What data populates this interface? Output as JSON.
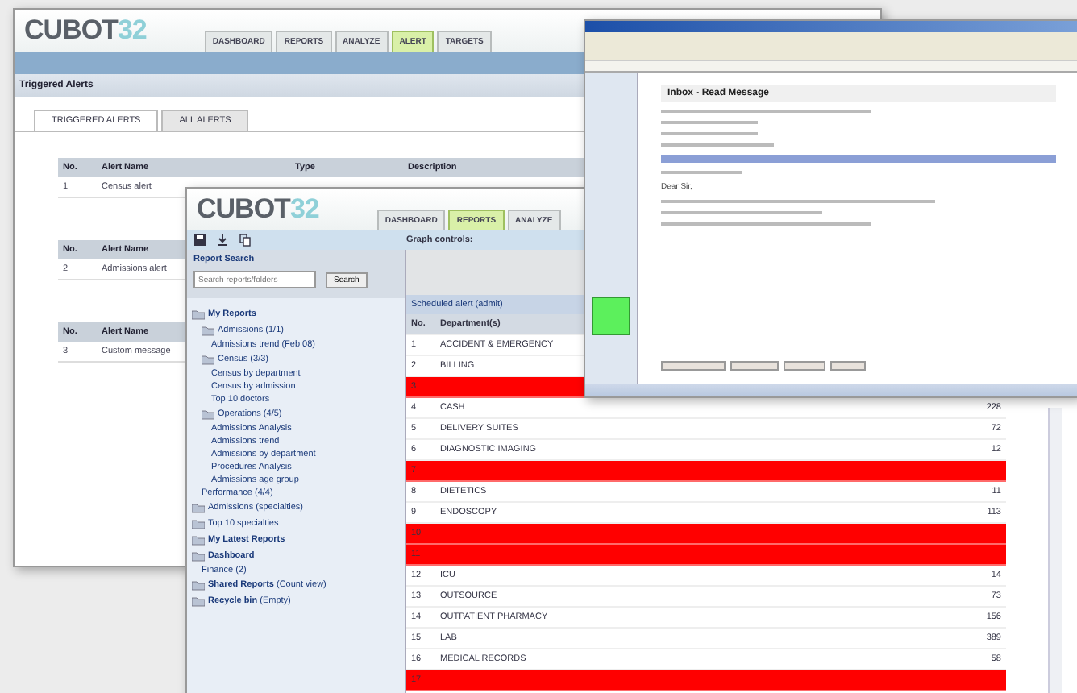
{
  "back_window": {
    "logo": {
      "text": "CUBOT",
      "mark": "32"
    },
    "nav": [
      {
        "label": "DASHBOARD",
        "selected": false
      },
      {
        "label": "REPORTS",
        "selected": false
      },
      {
        "label": "ANALYZE",
        "selected": false
      },
      {
        "label": "ALERT",
        "selected": true
      },
      {
        "label": "TARGETS",
        "selected": false
      }
    ],
    "section_title": "Triggered Alerts",
    "tabs": [
      {
        "label": "TRIGGERED ALERTS",
        "selected": true
      },
      {
        "label": "ALL ALERTS",
        "selected": false
      }
    ],
    "alert_tables": [
      {
        "columns": [
          "No.",
          "Alert Name",
          "Type",
          "Description"
        ],
        "rows": [
          [
            "1",
            "Census alert"
          ]
        ]
      },
      {
        "columns": [
          "No.",
          "Alert Name"
        ],
        "rows": [
          [
            "2",
            "Admissions alert"
          ]
        ]
      },
      {
        "columns": [
          "No.",
          "Alert Name"
        ],
        "rows": [
          [
            "3",
            "Custom message"
          ]
        ]
      }
    ]
  },
  "reports_window": {
    "logo": {
      "text": "CUBOT",
      "mark": "32"
    },
    "nav": [
      {
        "label": "DASHBOARD",
        "selected": false
      },
      {
        "label": "REPORTS",
        "selected": true
      },
      {
        "label": "ANALYZE",
        "selected": false
      }
    ],
    "graph_controls": "Graph controls:",
    "search": {
      "title": "Report Search",
      "placeholder": "Search reports/folders",
      "button": "Search"
    },
    "tree": [
      {
        "label": "My Reports",
        "bold": true,
        "children": [
          {
            "label": "Admissions (1/1)",
            "bold": false,
            "children": [
              {
                "label": "Admissions trend (Feb 08)",
                "bold": false
              }
            ]
          },
          {
            "label": "Census (3/3)",
            "bold": false,
            "children": [
              {
                "label": "Census by department",
                "bold": false
              },
              {
                "label": "Census by admission",
                "bold": false
              },
              {
                "label": "Top 10 doctors",
                "bold": false
              }
            ]
          },
          {
            "label": "Operations (4/5)",
            "bold": false,
            "children": [
              {
                "label": "Admissions Analysis",
                "bold": false
              },
              {
                "label": "Admissions trend",
                "bold": false
              },
              {
                "label": "Admissions by department",
                "bold": false
              },
              {
                "label": "Procedures Analysis",
                "bold": false
              },
              {
                "label": "Admissions age group",
                "bold": false
              }
            ]
          },
          {
            "label": "Performance (4/4)",
            "bold": false
          }
        ]
      },
      {
        "label": "Admissions (specialties)",
        "bold": false
      },
      {
        "label": "Top 10 specialties",
        "bold": false
      },
      {
        "label": "My Latest Reports",
        "bold": true
      },
      {
        "label": "Dashboard",
        "bold": true,
        "children": [
          {
            "label": "Finance (2)",
            "bold": false
          }
        ]
      },
      {
        "label": "Shared Reports",
        "note": "(Count view)",
        "bold": true
      },
      {
        "label": "Recycle bin",
        "note": "(Empty)",
        "bold": true
      }
    ],
    "table": {
      "title": "Scheduled alert (admit)",
      "columns": [
        "No.",
        "Department(s)"
      ],
      "rows": [
        {
          "no": "1",
          "name": "ACCIDENT & EMERGENCY",
          "value": "",
          "alert": false
        },
        {
          "no": "2",
          "name": "BILLING",
          "value": "",
          "alert": false
        },
        {
          "no": "3",
          "name": "",
          "value": "",
          "alert": true
        },
        {
          "no": "4",
          "name": "CASH",
          "value": "228",
          "alert": false
        },
        {
          "no": "5",
          "name": "DELIVERY SUITES",
          "value": "72",
          "alert": false
        },
        {
          "no": "6",
          "name": "DIAGNOSTIC IMAGING",
          "value": "12",
          "alert": false
        },
        {
          "no": "7",
          "name": "",
          "value": "",
          "alert": true
        },
        {
          "no": "8",
          "name": "DIETETICS",
          "value": "11",
          "alert": false
        },
        {
          "no": "9",
          "name": "ENDOSCOPY",
          "value": "113",
          "alert": false
        },
        {
          "no": "10",
          "name": "",
          "value": "",
          "alert": true
        },
        {
          "no": "11",
          "name": "",
          "value": "",
          "alert": true
        },
        {
          "no": "12",
          "name": "ICU",
          "value": "14",
          "alert": false
        },
        {
          "no": "13",
          "name": "OUTSOURCE",
          "value": "73",
          "alert": false
        },
        {
          "no": "14",
          "name": "OUTPATIENT PHARMACY",
          "value": "156",
          "alert": false
        },
        {
          "no": "15",
          "name": "LAB",
          "value": "389",
          "alert": false
        },
        {
          "no": "16",
          "name": "MEDICAL RECORDS",
          "value": "58",
          "alert": false
        },
        {
          "no": "17",
          "name": "",
          "value": "",
          "alert": true
        }
      ]
    }
  },
  "mail_window": {
    "heading": "Inbox - Read Message",
    "greeting": "Dear Sir,"
  }
}
